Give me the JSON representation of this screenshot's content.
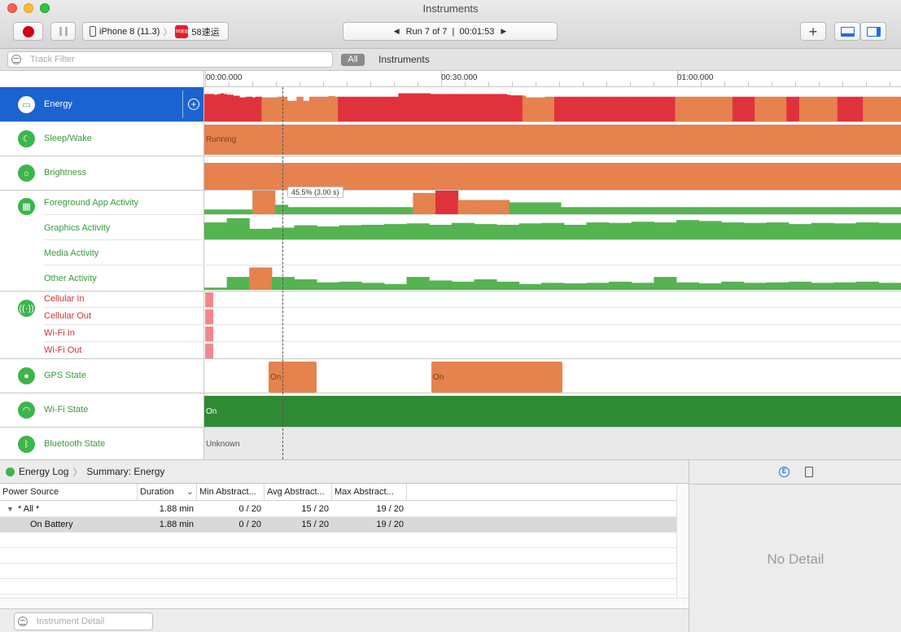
{
  "window": {
    "title": "Instruments"
  },
  "toolbar": {
    "device": "iPhone 8 (11.3)",
    "app_name": "58速运",
    "app_icon_text": "58速运",
    "run_label": "Run 7 of 7",
    "elapsed": "00:01:53",
    "add_label": "+"
  },
  "filter": {
    "track_placeholder": "Track Filter",
    "scope_all": "All",
    "scope_instruments": "Instruments"
  },
  "ruler": {
    "labels": [
      "00:00.000",
      "00:30.000",
      "01:00.000"
    ]
  },
  "tracks": {
    "energy": "Energy",
    "sleep_wake": "Sleep/Wake",
    "sleep_wake_value": "Running",
    "brightness": "Brightness",
    "cpu_group": [
      "Foreground App Activity",
      "Graphics Activity",
      "Media Activity",
      "Other Activity"
    ],
    "network_group": [
      "Cellular In",
      "Cellular Out",
      "Wi-Fi In",
      "Wi-Fi Out"
    ],
    "gps": "GPS State",
    "gps_values": [
      "On",
      "On"
    ],
    "wifi": "Wi-Fi State",
    "wifi_value": "On",
    "bluetooth": "Bluetooth State",
    "bluetooth_value": "Unknown"
  },
  "tooltip": "45.5% (3.00 s)",
  "colors": {
    "energy_high": "#e0323d",
    "energy_mid": "#e5824e",
    "activity_low": "#55b451",
    "activity_mid": "#e5824e",
    "activity_high": "#e0323d",
    "wifi_on": "#2f8a34"
  },
  "series": {
    "energy_levels": [
      3,
      3,
      3,
      3,
      3,
      3,
      3,
      3,
      3,
      3,
      3,
      3,
      3,
      3,
      3,
      3,
      3,
      3,
      2,
      2,
      2,
      2,
      2,
      2,
      2,
      2,
      2,
      2,
      2,
      2,
      2,
      2,
      2,
      2,
      2,
      2,
      2,
      2,
      2,
      2,
      2,
      2,
      3,
      3,
      3,
      3,
      3,
      3,
      3,
      3,
      3,
      3,
      3,
      3,
      3,
      3,
      3,
      3,
      3,
      3,
      3,
      3,
      3,
      3,
      3,
      3,
      3,
      3,
      3,
      3,
      3,
      3,
      3,
      3,
      3,
      3,
      3,
      3,
      3,
      3,
      3,
      3,
      3,
      3,
      3,
      3,
      3,
      3,
      3,
      3,
      3,
      3,
      3,
      3,
      3,
      3,
      3,
      3,
      3,
      3,
      2,
      2,
      2,
      2,
      2,
      2,
      2,
      2,
      2,
      2,
      3,
      3,
      3,
      3,
      3,
      3,
      3,
      3,
      3,
      3,
      3,
      3,
      3,
      3,
      3,
      3,
      3,
      3,
      3,
      3,
      3,
      3,
      3,
      3,
      3,
      3,
      3,
      3,
      3,
      3,
      3,
      3,
      3,
      3,
      3,
      3,
      3,
      3,
      2,
      2,
      2,
      2,
      2,
      2,
      2,
      2,
      2,
      2,
      2,
      2,
      2,
      2,
      2,
      2,
      2,
      2,
      3,
      3,
      3,
      3,
      3,
      3,
      3,
      2,
      2,
      2,
      2,
      2,
      2,
      2,
      2,
      2,
      2,
      3,
      3,
      3,
      3,
      2,
      2,
      2,
      2,
      2,
      2,
      2,
      2,
      2,
      2,
      2,
      2,
      3,
      3,
      3,
      3,
      3,
      3,
      3,
      3,
      2,
      2,
      2,
      2,
      2,
      2,
      2,
      2,
      2,
      2,
      2,
      2,
      2
    ],
    "energy_values": [
      0.8,
      0.8,
      0.8,
      0.78,
      0.8,
      0.82,
      0.8,
      0.78,
      0.78,
      0.75,
      0.75,
      0.7,
      0.7,
      0.72,
      0.72,
      0.7,
      0.72,
      0.72,
      0.7,
      0.7,
      0.7,
      0.7,
      0.7,
      0.72,
      0.72,
      0.72,
      0.6,
      0.6,
      0.6,
      0.72,
      0.72,
      0.6,
      0.6,
      0.72,
      0.72,
      0.72,
      0.72,
      0.72,
      0.72,
      0.74,
      0.74,
      0.72,
      0.72,
      0.72,
      0.72,
      0.72,
      0.72,
      0.72,
      0.72,
      0.72,
      0.72,
      0.72,
      0.72,
      0.72,
      0.72,
      0.72,
      0.72,
      0.72,
      0.72,
      0.72,
      0.72,
      0.82,
      0.82,
      0.82,
      0.82,
      0.82,
      0.82,
      0.82,
      0.82,
      0.82,
      0.82,
      0.8,
      0.8,
      0.8,
      0.8,
      0.8,
      0.8,
      0.8,
      0.8,
      0.8,
      0.8,
      0.8,
      0.8,
      0.8,
      0.8,
      0.8,
      0.8,
      0.8,
      0.8,
      0.8,
      0.8,
      0.8,
      0.8,
      0.8,
      0.8,
      0.78,
      0.76,
      0.76,
      0.76,
      0.76,
      0.75,
      0.7,
      0.7,
      0.7,
      0.7,
      0.7,
      0.7,
      0.72,
      0.72,
      0.72,
      0.72,
      0.72,
      0.72,
      0.72,
      0.72,
      0.72,
      0.72,
      0.72,
      0.72,
      0.72,
      0.72,
      0.72,
      0.72,
      0.72,
      0.72,
      0.72,
      0.72,
      0.72,
      0.72,
      0.72,
      0.72,
      0.72,
      0.72,
      0.72,
      0.72,
      0.72,
      0.72,
      0.72,
      0.72,
      0.72,
      0.72,
      0.72,
      0.72,
      0.72,
      0.72,
      0.72,
      0.72,
      0.72,
      0.72,
      0.72,
      0.72,
      0.72,
      0.72,
      0.72,
      0.72,
      0.72,
      0.72,
      0.72,
      0.72,
      0.72,
      0.72,
      0.72,
      0.72,
      0.72,
      0.72,
      0.72,
      0.72,
      0.72,
      0.72,
      0.72,
      0.72,
      0.72,
      0.72,
      0.72,
      0.72,
      0.72,
      0.72,
      0.72,
      0.72,
      0.72,
      0.72,
      0.72,
      0.72,
      0.72,
      0.72,
      0.72,
      0.72,
      0.72,
      0.72,
      0.72,
      0.72,
      0.72,
      0.72,
      0.72,
      0.72,
      0.72,
      0.72,
      0.72,
      0.72,
      0.72,
      0.72,
      0.72,
      0.72,
      0.72,
      0.72,
      0.72,
      0.72,
      0.72,
      0.72,
      0.72,
      0.72,
      0.72,
      0.72,
      0.72,
      0.72,
      0.72,
      0.72,
      0.72,
      0.72
    ],
    "fg_app": [
      0.2,
      0.2,
      0.2,
      0.2,
      0.2,
      0.2,
      0.2,
      0.2,
      0.2,
      0.2,
      0.2,
      0.2,
      0.2,
      0.2,
      0.2,
      1.0,
      1.0,
      1.0,
      1.0,
      1.0,
      1.0,
      1.0,
      0.4,
      0.4,
      0.4,
      0.4,
      0.3,
      0.3,
      0.3,
      0.3,
      0.3,
      0.3,
      0.3,
      0.3,
      0.3,
      0.3,
      0.3,
      0.3,
      0.3,
      0.3,
      0.3,
      0.3,
      0.3,
      0.3,
      0.3,
      0.3,
      0.3,
      0.3,
      0.3,
      0.3,
      0.3,
      0.3,
      0.3,
      0.3,
      0.3,
      0.3,
      0.3,
      0.3,
      0.3,
      0.3,
      0.3,
      0.3,
      0.3,
      0.3,
      0.3,
      0.9,
      0.9,
      0.9,
      0.9,
      0.9,
      0.9,
      0.9,
      1.2,
      1.2,
      1.2,
      1.2,
      1.2,
      1.2,
      1.2,
      0.6,
      0.6,
      0.6,
      0.6,
      0.6,
      0.6,
      0.6,
      0.6,
      0.6,
      0.6,
      0.6,
      0.6,
      0.6,
      0.6,
      0.6,
      0.6,
      0.5,
      0.5,
      0.5,
      0.5,
      0.5,
      0.5,
      0.5,
      0.5,
      0.5,
      0.5,
      0.5,
      0.5,
      0.5,
      0.5,
      0.5,
      0.5,
      0.3,
      0.3,
      0.3,
      0.3,
      0.3,
      0.3,
      0.3,
      0.3,
      0.3,
      0.3,
      0.3,
      0.3,
      0.3,
      0.3,
      0.3,
      0.3,
      0.3,
      0.3,
      0.3,
      0.3,
      0.3,
      0.3,
      0.3,
      0.3,
      0.3,
      0.3,
      0.3,
      0.3,
      0.3,
      0.3,
      0.3,
      0.3,
      0.3,
      0.3,
      0.3,
      0.3,
      0.3,
      0.3,
      0.3,
      0.3,
      0.3,
      0.3,
      0.3,
      0.3,
      0.3,
      0.3,
      0.3,
      0.3,
      0.3,
      0.3,
      0.3,
      0.3,
      0.3,
      0.3,
      0.3,
      0.3,
      0.3,
      0.3,
      0.3,
      0.3,
      0.3,
      0.3,
      0.3,
      0.3,
      0.3,
      0.3,
      0.3,
      0.3,
      0.3,
      0.3,
      0.3,
      0.3,
      0.3,
      0.3,
      0.3,
      0.3,
      0.3,
      0.3,
      0.3,
      0.3,
      0.3,
      0.3,
      0.3,
      0.3,
      0.3,
      0.3,
      0.3,
      0.3,
      0.3,
      0.3,
      0.3,
      0.3,
      0.3,
      0.3,
      0.3,
      0.3,
      0.3,
      0.3,
      0.3,
      0.3,
      0.3,
      0.3,
      0.3,
      0.3,
      0.3,
      0.3
    ],
    "fg_colors": [
      1,
      1,
      1,
      1,
      1,
      1,
      1,
      1,
      1,
      1,
      1,
      1,
      1,
      1,
      1,
      2,
      2,
      2,
      2,
      2,
      2,
      2,
      1,
      1,
      1,
      1,
      1,
      1,
      1,
      1,
      1,
      1,
      1,
      1,
      1,
      1,
      1,
      1,
      1,
      1,
      1,
      1,
      1,
      1,
      1,
      1,
      1,
      1,
      1,
      1,
      1,
      1,
      1,
      1,
      1,
      1,
      1,
      1,
      1,
      1,
      1,
      1,
      1,
      1,
      1,
      2,
      2,
      2,
      2,
      2,
      2,
      2,
      3,
      3,
      3,
      3,
      3,
      3,
      3,
      2,
      2,
      2,
      2,
      2,
      2,
      2,
      2,
      2,
      2,
      2,
      2,
      2,
      2,
      2,
      2,
      1,
      1,
      1,
      1,
      1,
      1,
      1,
      1,
      1,
      1,
      1,
      1,
      1,
      1,
      1,
      1,
      1,
      1,
      1,
      1,
      1,
      1,
      1,
      1,
      1,
      1,
      1,
      1,
      1,
      1,
      1,
      1,
      1,
      1,
      1,
      1,
      1,
      1,
      1,
      1,
      1,
      1,
      1,
      1,
      1,
      1,
      1,
      1,
      1,
      1,
      1,
      1,
      1,
      1,
      1,
      1,
      1,
      1,
      1,
      1,
      1,
      1,
      1,
      1,
      1,
      1,
      1,
      1,
      1,
      1,
      1,
      1,
      1,
      1,
      1,
      1,
      1,
      1,
      1,
      1,
      1,
      1,
      1,
      1,
      1,
      1,
      1,
      1,
      1,
      1,
      1,
      1,
      1,
      1,
      1,
      1,
      1,
      1,
      1,
      1,
      1,
      1,
      1,
      1,
      1,
      1,
      1,
      1,
      1,
      1,
      1,
      1,
      1,
      1,
      1,
      1,
      1,
      1,
      1,
      1,
      1,
      1,
      1,
      1,
      1,
      1,
      1,
      1,
      1,
      1
    ],
    "graphics": [
      0.72,
      0.72,
      0.72,
      0.72,
      0.72,
      0.72,
      0.72,
      0.9,
      0.9,
      0.9,
      0.9,
      0.9,
      0.9,
      0.9,
      0.45,
      0.45,
      0.45,
      0.45,
      0.45,
      0.45,
      0.45,
      0.5,
      0.5,
      0.5,
      0.5,
      0.5,
      0.5,
      0.5,
      0.6,
      0.6,
      0.6,
      0.6,
      0.6,
      0.6,
      0.6,
      0.55,
      0.55,
      0.55,
      0.55,
      0.55,
      0.55,
      0.55,
      0.6,
      0.6,
      0.6,
      0.6,
      0.6,
      0.6,
      0.6,
      0.62,
      0.62,
      0.62,
      0.62,
      0.62,
      0.62,
      0.62,
      0.65,
      0.65,
      0.65,
      0.65,
      0.65,
      0.65,
      0.65,
      0.68,
      0.68,
      0.68,
      0.68,
      0.68,
      0.68,
      0.68,
      0.62,
      0.62,
      0.62,
      0.62,
      0.62,
      0.62,
      0.62,
      0.7,
      0.7,
      0.7,
      0.7,
      0.7,
      0.7,
      0.7,
      0.65,
      0.65,
      0.65,
      0.65,
      0.65,
      0.65,
      0.65,
      0.62,
      0.62,
      0.62,
      0.62,
      0.62,
      0.62,
      0.62,
      0.68,
      0.68,
      0.68,
      0.68,
      0.68,
      0.68,
      0.68,
      0.7,
      0.7,
      0.7,
      0.7,
      0.7,
      0.7,
      0.7,
      0.62,
      0.62,
      0.62,
      0.62,
      0.62,
      0.62,
      0.62,
      0.72,
      0.72,
      0.72,
      0.72,
      0.72,
      0.72,
      0.72,
      0.7,
      0.7,
      0.7,
      0.7,
      0.7,
      0.7,
      0.7,
      0.75,
      0.75,
      0.75,
      0.75,
      0.75,
      0.75,
      0.75,
      0.72,
      0.72,
      0.72,
      0.72,
      0.72,
      0.72,
      0.72,
      0.82,
      0.82,
      0.82,
      0.82,
      0.82,
      0.82,
      0.82,
      0.78,
      0.78,
      0.78,
      0.78,
      0.78,
      0.78,
      0.78,
      0.72,
      0.72,
      0.72,
      0.72,
      0.72,
      0.72,
      0.72,
      0.7,
      0.7,
      0.7,
      0.7,
      0.7,
      0.7,
      0.7,
      0.72,
      0.72,
      0.72,
      0.72,
      0.72,
      0.72,
      0.72,
      0.65,
      0.65,
      0.65,
      0.65,
      0.65,
      0.65,
      0.65,
      0.7,
      0.7,
      0.7,
      0.7,
      0.7,
      0.7,
      0.7,
      0.68,
      0.68,
      0.68,
      0.68,
      0.68,
      0.68,
      0.68,
      0.72,
      0.72,
      0.72,
      0.72,
      0.72,
      0.72,
      0.72,
      0.7,
      0.7,
      0.7,
      0.7,
      0.7,
      0.7,
      0.7
    ],
    "other": [
      0.1,
      0.1,
      0.1,
      0.1,
      0.1,
      0.1,
      0.1,
      0.55,
      0.55,
      0.55,
      0.55,
      0.55,
      0.55,
      0.55,
      0.95,
      0.95,
      0.95,
      0.95,
      0.95,
      0.95,
      0.95,
      0.55,
      0.55,
      0.55,
      0.55,
      0.55,
      0.55,
      0.55,
      0.45,
      0.45,
      0.45,
      0.45,
      0.45,
      0.45,
      0.45,
      0.32,
      0.32,
      0.32,
      0.32,
      0.32,
      0.32,
      0.32,
      0.35,
      0.35,
      0.35,
      0.35,
      0.35,
      0.35,
      0.35,
      0.3,
      0.3,
      0.3,
      0.3,
      0.3,
      0.3,
      0.3,
      0.25,
      0.25,
      0.25,
      0.25,
      0.25,
      0.25,
      0.25,
      0.55,
      0.55,
      0.55,
      0.55,
      0.55,
      0.55,
      0.55,
      0.4,
      0.4,
      0.4,
      0.4,
      0.4,
      0.4,
      0.4,
      0.35,
      0.35,
      0.35,
      0.35,
      0.35,
      0.35,
      0.35,
      0.45,
      0.45,
      0.45,
      0.45,
      0.45,
      0.45,
      0.45,
      0.35,
      0.35,
      0.35,
      0.35,
      0.35,
      0.35,
      0.35,
      0.25,
      0.25,
      0.25,
      0.25,
      0.25,
      0.25,
      0.25,
      0.3,
      0.3,
      0.3,
      0.3,
      0.3,
      0.3,
      0.3,
      0.28,
      0.28,
      0.28,
      0.28,
      0.28,
      0.28,
      0.28,
      0.3,
      0.3,
      0.3,
      0.3,
      0.3,
      0.3,
      0.3,
      0.35,
      0.35,
      0.35,
      0.35,
      0.35,
      0.35,
      0.35,
      0.3,
      0.3,
      0.3,
      0.3,
      0.3,
      0.3,
      0.3,
      0.55,
      0.55,
      0.55,
      0.55,
      0.55,
      0.55,
      0.55,
      0.32,
      0.32,
      0.32,
      0.32,
      0.32,
      0.32,
      0.32,
      0.28,
      0.28,
      0.28,
      0.28,
      0.28,
      0.28,
      0.28,
      0.35,
      0.35,
      0.35,
      0.35,
      0.35,
      0.35,
      0.35,
      0.3,
      0.3,
      0.3,
      0.3,
      0.3,
      0.3,
      0.3,
      0.32,
      0.32,
      0.32,
      0.32,
      0.32,
      0.32,
      0.32,
      0.35,
      0.35,
      0.35,
      0.35,
      0.35,
      0.35,
      0.35,
      0.3,
      0.3,
      0.3,
      0.3,
      0.3,
      0.3,
      0.3,
      0.32,
      0.32,
      0.32,
      0.32,
      0.32,
      0.32,
      0.32,
      0.35,
      0.35,
      0.35,
      0.35,
      0.35,
      0.35,
      0.35,
      0.3,
      0.3,
      0.3,
      0.3,
      0.3,
      0.3,
      0.3
    ],
    "other_colors": [
      1,
      1,
      1,
      1,
      1,
      1,
      1,
      1,
      1,
      1,
      1,
      1,
      1,
      1,
      2,
      2,
      2,
      2,
      2,
      2,
      2,
      1,
      1,
      1,
      1,
      1,
      1,
      1,
      1,
      1,
      1,
      1,
      1,
      1,
      1,
      1,
      1,
      1,
      1,
      1,
      1,
      1,
      1,
      1,
      1,
      1,
      1,
      1,
      1,
      1,
      1,
      1,
      1,
      1,
      1,
      1,
      1,
      1,
      1,
      1,
      1,
      1,
      1,
      1,
      1,
      1,
      1,
      1,
      1,
      1,
      1,
      1,
      1,
      1,
      1,
      1,
      1,
      1,
      1,
      1,
      1,
      1,
      1,
      1,
      1,
      1,
      1,
      1,
      1,
      1,
      1,
      1,
      1,
      1,
      1,
      1,
      1,
      1,
      1,
      1,
      1,
      1,
      1,
      1,
      1,
      1,
      1,
      1,
      1,
      1,
      1,
      1,
      1,
      1,
      1,
      1,
      1,
      1,
      1,
      1,
      1,
      1,
      1,
      1,
      1,
      1,
      1,
      1,
      1,
      1,
      1,
      1,
      1,
      1,
      1,
      1,
      1,
      1,
      1,
      1,
      1,
      1,
      1,
      1,
      1,
      1,
      1,
      1,
      1,
      1,
      1,
      1,
      1,
      1,
      1,
      1,
      1,
      1,
      1,
      1,
      1,
      1,
      1,
      1,
      1,
      1,
      1,
      1,
      1,
      1,
      1,
      1,
      1,
      1,
      1,
      1,
      1,
      1,
      1,
      1,
      1,
      1,
      1,
      1,
      1,
      1,
      1,
      1,
      1,
      1,
      1,
      1,
      1,
      1,
      1,
      1,
      1,
      1,
      1,
      1,
      1,
      1,
      1,
      1,
      1,
      1,
      1,
      1,
      1,
      1,
      1,
      1,
      1,
      1,
      1,
      1,
      1,
      1,
      1,
      1,
      1
    ]
  },
  "detail": {
    "breadcrumb": [
      "Energy Log",
      "Summary: Energy"
    ],
    "columns": [
      "Power Source",
      "Duration",
      "Min Abstract...",
      "Avg Abstract...",
      "Max Abstract..."
    ],
    "rows": [
      {
        "name": "* All *",
        "duration": "1.88 min",
        "min": "0 / 20",
        "avg": "15 / 20",
        "max": "19 / 20"
      },
      {
        "name": "On Battery",
        "duration": "1.88 min",
        "min": "0 / 20",
        "avg": "15 / 20",
        "max": "19 / 20"
      }
    ],
    "filter_placeholder": "Instrument Detail",
    "no_detail": "No Detail"
  }
}
